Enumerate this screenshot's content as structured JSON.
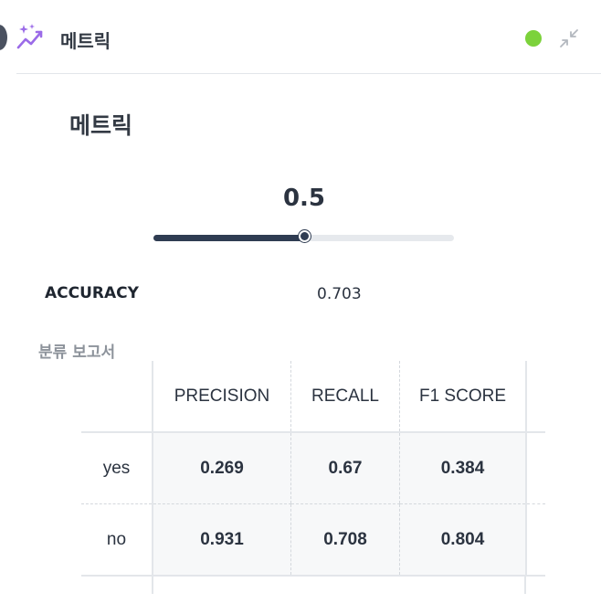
{
  "header": {
    "title": "메트릭",
    "status_color": "#7cd23b",
    "icons": [
      "sparkle-chart-icon",
      "collapse-icon"
    ]
  },
  "main": {
    "title": "메트릭",
    "threshold": {
      "value_label": "0.5",
      "value": 0.5,
      "min": 0,
      "max": 1
    },
    "accuracy": {
      "label": "ACCURACY",
      "value": "0.703"
    },
    "report": {
      "title": "분류 보고서",
      "columns": [
        "PRECISION",
        "RECALL",
        "F1 SCORE"
      ],
      "rows": [
        {
          "label": "yes",
          "values": [
            "0.269",
            "0.67",
            "0.384"
          ]
        },
        {
          "label": "no",
          "values": [
            "0.931",
            "0.708",
            "0.804"
          ]
        }
      ]
    }
  },
  "colors": {
    "accent": "#2f3c52",
    "icon_purple": "#9b6be8",
    "status": "#7cd23b"
  }
}
